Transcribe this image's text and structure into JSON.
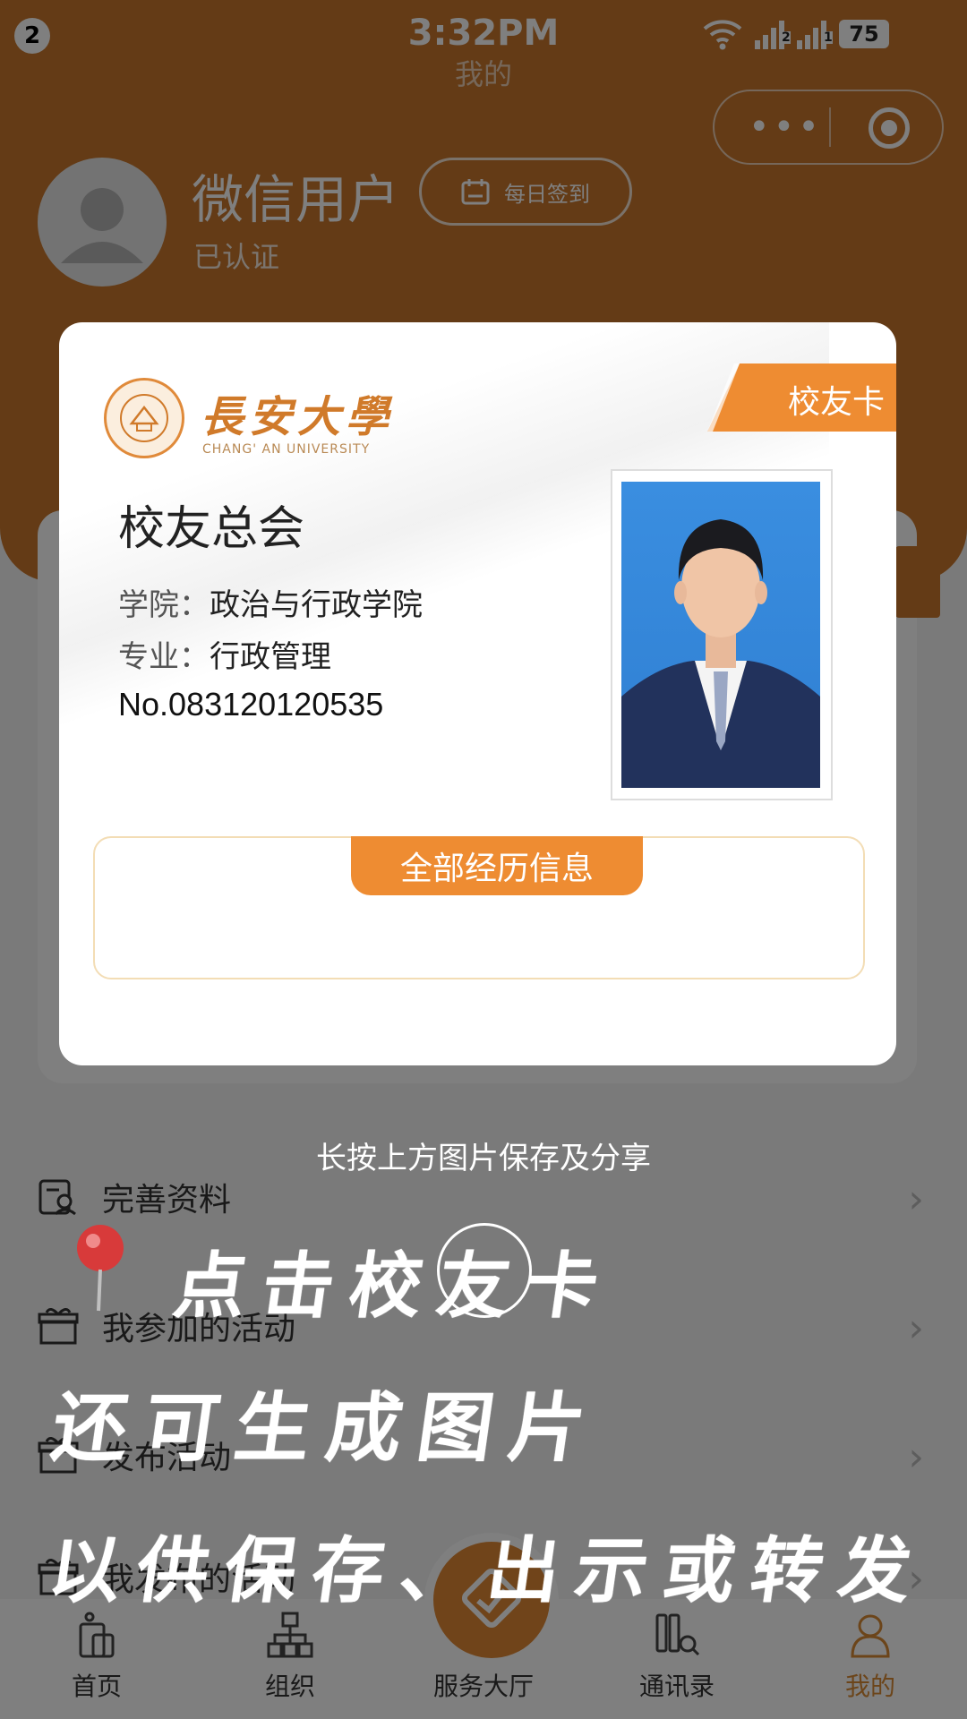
{
  "status_bar": {
    "notification_count": "2",
    "time": "3:32PM",
    "battery": "75",
    "sim1": "1",
    "sim2": "2"
  },
  "nav": {
    "title": "我的"
  },
  "profile": {
    "name": "微信用户",
    "status": "已认证",
    "checkin_label": "每日签到"
  },
  "alumni_card": {
    "badge": "校友卡",
    "university_name": "長安大學",
    "university_en": "CHANG' AN UNIVERSITY",
    "organization": "校友总会",
    "college_label": "学院：",
    "college": "政治与行政学院",
    "major_label": "专业：",
    "major": "行政管理",
    "number": "No.083120120535",
    "experience_tab": "全部经历信息"
  },
  "save_hint": "长按上方图片保存及分享",
  "menu": [
    {
      "label": "完善资料",
      "icon": "profile-edit-icon"
    },
    {
      "label": "我参加的活动",
      "icon": "gift-icon"
    },
    {
      "label": "发布活动",
      "icon": "gift-icon"
    },
    {
      "label": "我发布的活动",
      "icon": "gift-icon"
    }
  ],
  "annotation": {
    "line1": "点击校友卡",
    "line2": "还可生成图片",
    "line3": "以供保存、出示或转发"
  },
  "tabbar": [
    {
      "label": "首页",
      "icon": "home-icon"
    },
    {
      "label": "组织",
      "icon": "org-chart-icon"
    },
    {
      "label": "服务大厅",
      "icon": "service-icon"
    },
    {
      "label": "通讯录",
      "icon": "contacts-icon"
    },
    {
      "label": "我的",
      "icon": "profile-icon",
      "active": true
    }
  ],
  "colors": {
    "brand_orange": "#c9772c",
    "accent_orange": "#ee8c32",
    "overlay": "rgba(0,0,0,0.5)"
  }
}
